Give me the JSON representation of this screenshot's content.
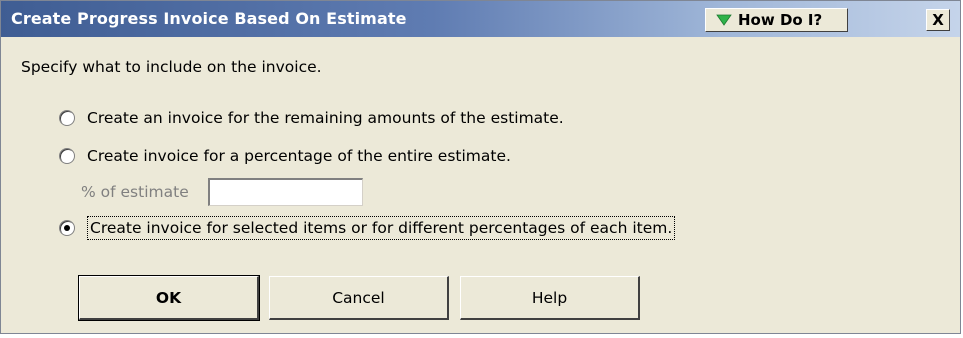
{
  "window": {
    "title": "Create Progress Invoice Based On Estimate",
    "how_do_i_label": "How Do I?",
    "close_label": "X"
  },
  "instruction": "Specify what to include on the invoice.",
  "options": [
    {
      "label": "Create an invoice for the remaining amounts of the estimate.",
      "selected": false
    },
    {
      "label": "Create invoice for a percentage of the entire estimate.",
      "selected": false
    },
    {
      "label": "Create invoice for selected items or for different percentages of each item.",
      "selected": true
    }
  ],
  "percent_field": {
    "label": "% of estimate",
    "value": ""
  },
  "buttons": {
    "ok": "OK",
    "cancel": "Cancel",
    "help": "Help"
  },
  "colors": {
    "titlebar_start": "#3f5d93",
    "titlebar_end": "#c5d4ea",
    "dialog_bg": "#ece9d8",
    "how_do_i_arrow": "#2fb34a"
  }
}
